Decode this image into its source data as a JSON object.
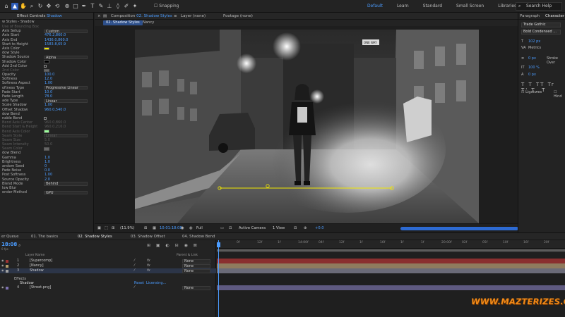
{
  "toolbar": {
    "snapping_label": "Snapping",
    "workspaces": [
      "Default",
      "Learn",
      "Standard",
      "Small Screen",
      "Libraries"
    ],
    "active_workspace": "Default",
    "search_placeholder": "Search Help"
  },
  "effect_controls": {
    "tab_prefix": "Effect Controls",
    "tab_layer": "Shadow",
    "header": "w Styles - Shadow",
    "rows": [
      {
        "label": "Use of Bounding Box",
        "value": "",
        "kind": "text",
        "disabled": true
      },
      {
        "label": "Axis Setup",
        "value": "Custom",
        "kind": "dropdown"
      },
      {
        "label": "Axis Start",
        "value": "476.2,860.0",
        "kind": "value"
      },
      {
        "label": "Axis End",
        "value": "1436.0,860.0",
        "kind": "value"
      },
      {
        "label": "Start to Height",
        "value": "1583.8,65.9",
        "kind": "value"
      },
      {
        "label": "Axis Color",
        "value": "",
        "kind": "swatch",
        "color": "#f2e800"
      },
      {
        "label": "dow Style",
        "value": "",
        "kind": "text"
      },
      {
        "label": "Shadow Source",
        "value": "Alpha",
        "kind": "dropdown"
      },
      {
        "label": "Shadow Color",
        "value": "",
        "kind": "swatch",
        "color": "#000000"
      },
      {
        "label": "Add 2nd Color",
        "value": "",
        "kind": "checkbox"
      },
      {
        "label": "2nd Color",
        "value": "",
        "kind": "swatch",
        "color": "#666666",
        "disabled": true
      },
      {
        "label": "Opacity",
        "value": "100.0",
        "kind": "value"
      },
      {
        "label": "Softness",
        "value": "12.0",
        "kind": "value"
      },
      {
        "label": "Softness Aspect",
        "value": "1.00",
        "kind": "value"
      },
      {
        "label": "oftness Type",
        "value": "Progressive Linear",
        "kind": "dropdown"
      },
      {
        "label": "Fade Start",
        "value": "10.0",
        "kind": "value"
      },
      {
        "label": "Fade Length",
        "value": "78.0",
        "kind": "value"
      },
      {
        "label": "ade Type",
        "value": "Linear",
        "kind": "dropdown"
      },
      {
        "label": "Scale Shadow",
        "value": "1.00",
        "kind": "value"
      },
      {
        "label": "Offset Shadow",
        "value": "960.0,540.0",
        "kind": "value"
      },
      {
        "label": "dow Bend",
        "value": "",
        "kind": "text"
      },
      {
        "label": "nable Bend",
        "value": "",
        "kind": "checkbox"
      },
      {
        "label": "Bend Axis Center",
        "value": "960.0,860.0",
        "kind": "value",
        "disabled": true
      },
      {
        "label": "Bend Start & Height",
        "value": "960.0,216.0",
        "kind": "value",
        "disabled": true
      },
      {
        "label": "Bend Axis Color",
        "value": "",
        "kind": "swatch",
        "color": "#9bff9b",
        "disabled": true
      },
      {
        "label": "Seam Style",
        "value": "Linear",
        "kind": "dropdown",
        "disabled": true
      },
      {
        "label": "Seam Size",
        "value": "5.0",
        "kind": "value",
        "disabled": true
      },
      {
        "label": "Seam Intensity",
        "value": "50.0",
        "kind": "value",
        "disabled": true
      },
      {
        "label": "Seam Color",
        "value": "",
        "kind": "swatch",
        "color": "#666666",
        "disabled": true
      },
      {
        "label": "dow Blend",
        "value": "",
        "kind": "text"
      },
      {
        "label": "Gamma",
        "value": "1.0",
        "kind": "value"
      },
      {
        "label": "Brightness",
        "value": "1.0",
        "kind": "value"
      },
      {
        "label": "andom Seed",
        "value": "0",
        "kind": "value"
      },
      {
        "label": "Fade Noise",
        "value": "0.0",
        "kind": "value"
      },
      {
        "label": "Post Softness",
        "value": "1.00",
        "kind": "value"
      },
      {
        "label": "Source Opacity",
        "value": "2.0",
        "kind": "value"
      },
      {
        "label": "Blend Mode",
        "value": "Behind",
        "kind": "dropdown"
      },
      {
        "label": "low Blur",
        "value": "",
        "kind": "text"
      },
      {
        "label": "ender Method",
        "value": "GPU",
        "kind": "dropdown"
      }
    ]
  },
  "viewer": {
    "comp_tab_prefix": "Composition",
    "comp_tab_name": "02. Shadow Styles",
    "layer_tab": "Layer (none)",
    "footage_tab": "Footage (none)",
    "sub_tabs": [
      "02. Shadow Styles",
      "Nancy"
    ],
    "active_sub_tab": "02. Shadow Styles",
    "zoom": "(11.9%)",
    "timecode": "10:01:18:08",
    "resolution": "Full",
    "camera": "Active Camera",
    "views": "1 View",
    "exposure": "+0.0",
    "street_sign": "ONE WAY",
    "scene_colors": {
      "shadow_axis": "#f2e800"
    }
  },
  "right_panel": {
    "tabs": [
      "Paragraph",
      "Character"
    ],
    "active_tab": "Character",
    "font_family": "Trade Gothic",
    "font_style": "Bold Condensed ...",
    "font_size": "102 px",
    "tracking_label": "Metrics",
    "line_percent": "100 %",
    "scale_v": "100 %",
    "baseline": "0 px",
    "stroke_label": "Stroke Over",
    "tsume": "0 %",
    "ligatures_label": "Ligatures",
    "hindi_label": "Hind"
  },
  "timeline": {
    "tabs": [
      "er Queue",
      "01. The basics",
      "02. Shadow Styles",
      "03. Shadow Offset",
      "04. Shadow Bend"
    ],
    "active_tab": "02. Shadow Styles",
    "timecode": "18:08",
    "fps": "0 fps",
    "col_layer_name": "Layer Name",
    "col_parent": "Parent & Link",
    "ruler_ticks": [
      "0f",
      "12f",
      "1f",
      "14:00f",
      "04f",
      "12f",
      "1f",
      "16f",
      "1f",
      "1f",
      "20:00f",
      "02f",
      "05f",
      "10f",
      "16f",
      "20f"
    ],
    "layers": [
      {
        "num": "1",
        "name": "[Supercomp]",
        "parent": "None",
        "label_color": "#9e3232",
        "bar_color": "#8a2f2f"
      },
      {
        "num": "2",
        "name": "[Nancy]",
        "parent": "None",
        "label_color": "#b49b6a",
        "bar_color": "#8f7b5e"
      },
      {
        "num": "3",
        "name": "Shadow",
        "parent": "None",
        "label_color": "#a0a0a0",
        "bar_color": "#6b6b78"
      },
      {
        "num": "4",
        "name": "[Street.png]",
        "parent": "None",
        "label_color": "#7d71b0",
        "bar_color": "#5f5a80"
      }
    ],
    "effects_label": "Effects",
    "effect_name": "Shadow",
    "reset_label": "Reset",
    "licensing_label": "Licensing..."
  },
  "watermark": "WWW.MAZTERIZES.COM"
}
